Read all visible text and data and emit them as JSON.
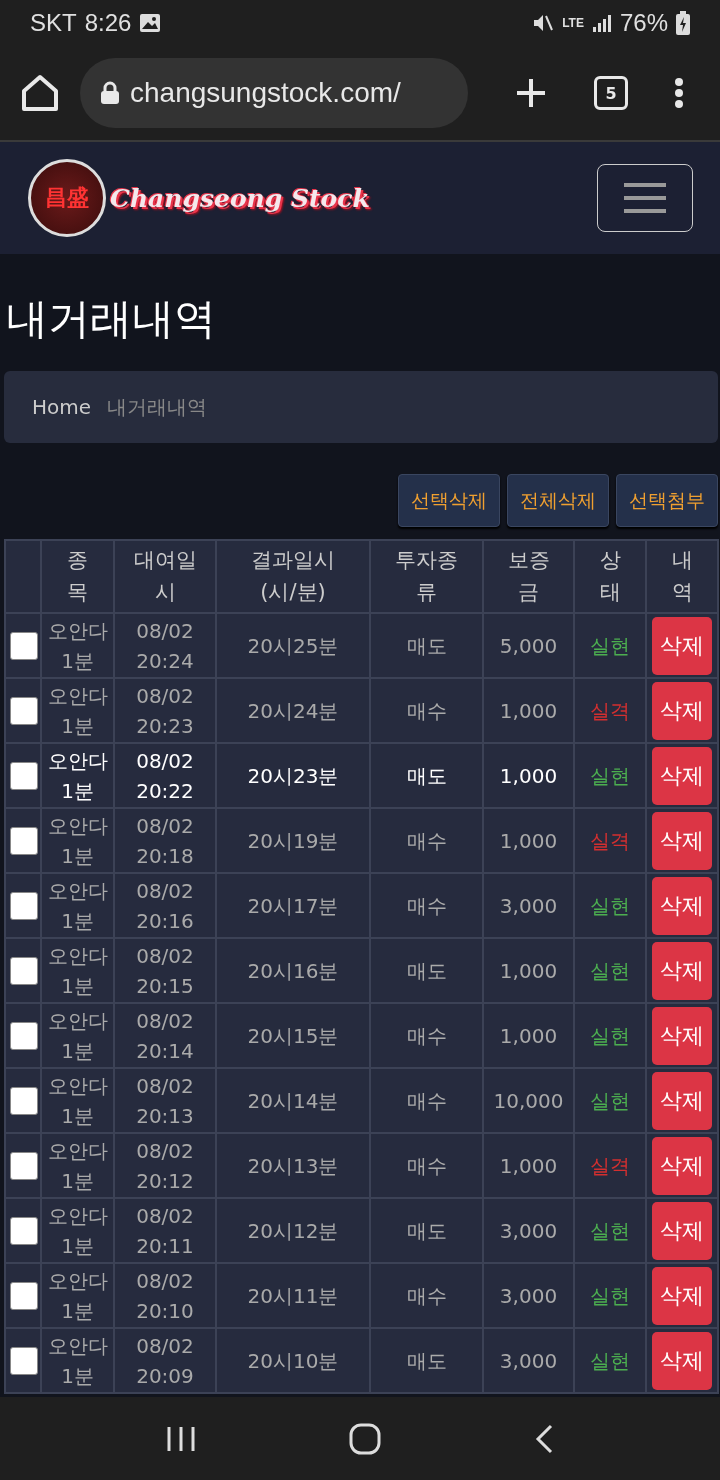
{
  "status_bar": {
    "carrier": "SKT",
    "time": "8:26",
    "network": "LTE",
    "battery": "76%"
  },
  "browser": {
    "url": "changsungstock.com/",
    "tab_count": "5"
  },
  "site_header": {
    "logo_mark": "昌盛",
    "logo_text": "Changseong Stock"
  },
  "page_title": "내거래내역",
  "breadcrumb": [
    {
      "label": "Home",
      "kind": "link"
    },
    {
      "label": "내거래내역",
      "kind": "current"
    }
  ],
  "actions": [
    "선택삭제",
    "전체삭제",
    "선택첨부"
  ],
  "table": {
    "columns": [
      "종목",
      "대여일시",
      "결과일시(시/분)",
      "투자종류",
      "보증금",
      "상태",
      "내역"
    ],
    "rows": [
      {
        "checked": false,
        "highlighted": false,
        "item": "오안다 1분",
        "date": "08/02 20:24",
        "result_time": "20시25분",
        "type": "매도",
        "deposit": "5,000",
        "status": {
          "text": "실현",
          "color": "#4caf50"
        },
        "action": "삭제"
      },
      {
        "checked": false,
        "highlighted": false,
        "item": "오안다 1분",
        "date": "08/02 20:23",
        "result_time": "20시24분",
        "type": "매수",
        "deposit": "1,000",
        "status": {
          "text": "실격",
          "color": "#d32f2f"
        },
        "action": "삭제"
      },
      {
        "checked": false,
        "highlighted": true,
        "item": "오안다 1분",
        "date": "08/02 20:22",
        "result_time": "20시23분",
        "type": "매도",
        "deposit": "1,000",
        "status": {
          "text": "실현",
          "color": "#4caf50"
        },
        "action": "삭제"
      },
      {
        "checked": false,
        "highlighted": false,
        "item": "오안다 1분",
        "date": "08/02 20:18",
        "result_time": "20시19분",
        "type": "매수",
        "deposit": "1,000",
        "status": {
          "text": "실격",
          "color": "#d32f2f"
        },
        "action": "삭제"
      },
      {
        "checked": false,
        "highlighted": false,
        "item": "오안다 1분",
        "date": "08/02 20:16",
        "result_time": "20시17분",
        "type": "매수",
        "deposit": "3,000",
        "status": {
          "text": "실현",
          "color": "#4caf50"
        },
        "action": "삭제"
      },
      {
        "checked": false,
        "highlighted": false,
        "item": "오안다 1분",
        "date": "08/02 20:15",
        "result_time": "20시16분",
        "type": "매도",
        "deposit": "1,000",
        "status": {
          "text": "실현",
          "color": "#4caf50"
        },
        "action": "삭제"
      },
      {
        "checked": false,
        "highlighted": false,
        "item": "오안다 1분",
        "date": "08/02 20:14",
        "result_time": "20시15분",
        "type": "매수",
        "deposit": "1,000",
        "status": {
          "text": "실현",
          "color": "#4caf50"
        },
        "action": "삭제"
      },
      {
        "checked": false,
        "highlighted": false,
        "item": "오안다 1분",
        "date": "08/02 20:13",
        "result_time": "20시14분",
        "type": "매수",
        "deposit": "10,000",
        "status": {
          "text": "실현",
          "color": "#4caf50"
        },
        "action": "삭제"
      },
      {
        "checked": false,
        "highlighted": false,
        "item": "오안다 1분",
        "date": "08/02 20:12",
        "result_time": "20시13분",
        "type": "매수",
        "deposit": "1,000",
        "status": {
          "text": "실격",
          "color": "#d32f2f"
        },
        "action": "삭제"
      },
      {
        "checked": false,
        "highlighted": false,
        "item": "오안다 1분",
        "date": "08/02 20:11",
        "result_time": "20시12분",
        "type": "매도",
        "deposit": "3,000",
        "status": {
          "text": "실현",
          "color": "#4caf50"
        },
        "action": "삭제"
      },
      {
        "checked": false,
        "highlighted": false,
        "item": "오안다 1분",
        "date": "08/02 20:10",
        "result_time": "20시11분",
        "type": "매수",
        "deposit": "3,000",
        "status": {
          "text": "실현",
          "color": "#4caf50"
        },
        "action": "삭제"
      },
      {
        "checked": false,
        "highlighted": false,
        "item": "오안다 1분",
        "date": "08/02 20:09",
        "result_time": "20시10분",
        "type": "매도",
        "deposit": "3,000",
        "status": {
          "text": "실현",
          "color": "#4caf50"
        },
        "action": "삭제"
      }
    ]
  }
}
